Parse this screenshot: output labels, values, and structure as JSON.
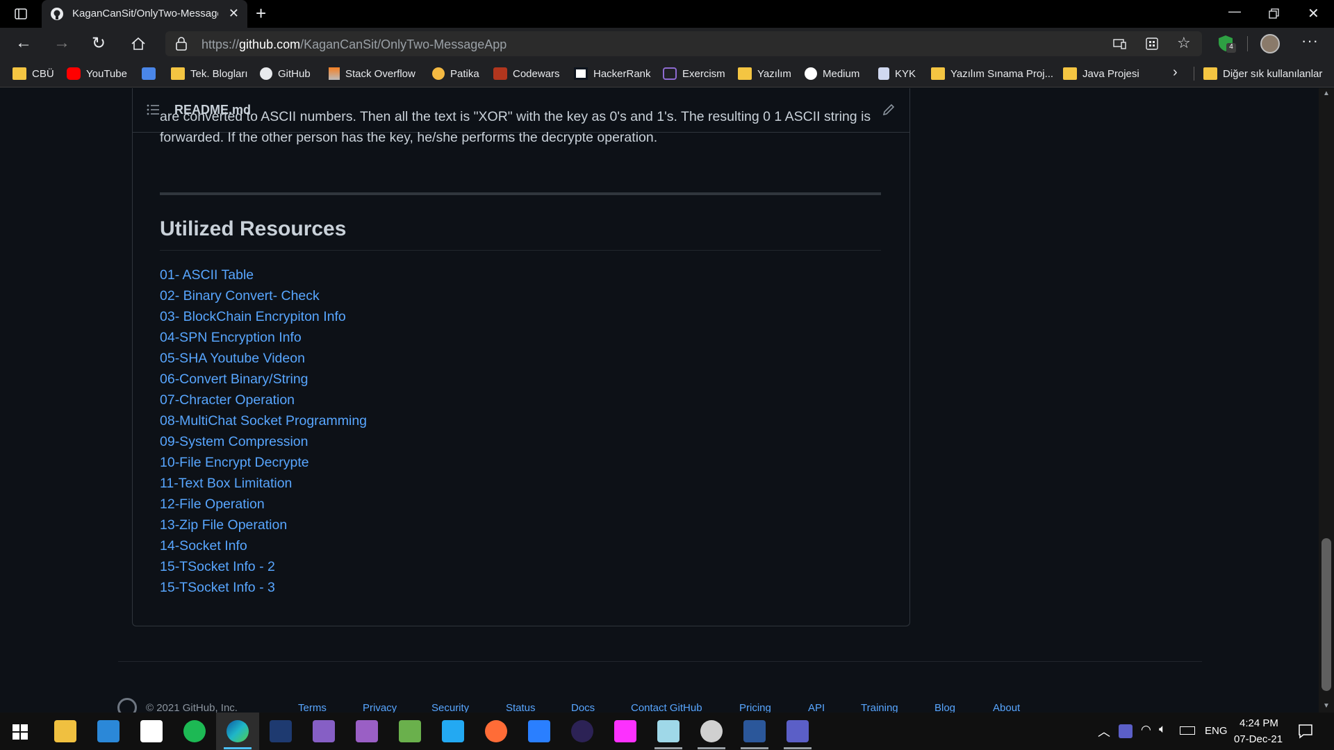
{
  "browser": {
    "tab_title": "KaganCanSit/OnlyTwo-MessageApp",
    "url_prefix": "https://",
    "url_domain": "github.com",
    "url_path": "/KaganCanSit/OnlyTwo-MessageApp",
    "extension_badge": "4"
  },
  "bookmarks": [
    {
      "label": "CBÜ",
      "icon": "folder-icon"
    },
    {
      "label": "YouTube",
      "icon": "youtube-icon"
    },
    {
      "label": "",
      "icon": "translate-icon"
    },
    {
      "label": "Tek. Blogları",
      "icon": "folder-icon"
    },
    {
      "label": "GitHub",
      "icon": "github-icon"
    },
    {
      "label": "Stack Overflow",
      "icon": "stackoverflow-icon"
    },
    {
      "label": "Patika",
      "icon": "patika-icon"
    },
    {
      "label": "Codewars",
      "icon": "codewars-icon"
    },
    {
      "label": "HackerRank",
      "icon": "hackerrank-icon"
    },
    {
      "label": "Exercism",
      "icon": "exercism-icon"
    },
    {
      "label": "Yazılım",
      "icon": "folder-icon"
    },
    {
      "label": "Medium",
      "icon": "medium-icon"
    },
    {
      "label": "KYK",
      "icon": "kyk-icon"
    },
    {
      "label": "Yazılım Sınama Proj...",
      "icon": "folder-icon"
    },
    {
      "label": "Java Projesi",
      "icon": "folder-icon"
    },
    {
      "label": "Diğer sık kullanılanlar",
      "icon": "folder-icon"
    }
  ],
  "readme": {
    "filename": "README.md",
    "intro_line1": "are converted to ASCII numbers. Then all the text is \"XOR\" with the key as 0's and 1's. The resulting 0 1 ASCII string is",
    "intro_line2": "forwarded. If the other person has the key, he/she performs the decrypte operation.",
    "section_title": "Utilized Resources",
    "resources": [
      "01- ASCII Table",
      "02- Binary Convert- Check",
      "03- BlockChain Encrypiton Info",
      "04-SPN Encryption Info",
      "05-SHA Youtube Videon",
      "06-Convert Binary/String",
      "07-Chracter Operation",
      "08-MultiChat Socket Programming",
      "09-System Compression",
      "10-File Encrypt Decrypte",
      "11-Text Box Limitation",
      "12-File Operation",
      "13-Zip File Operation",
      "14-Socket Info",
      "15-TSocket Info - 2",
      "15-TSocket Info - 3"
    ]
  },
  "footer": {
    "copyright": "© 2021 GitHub, Inc.",
    "links": [
      "Terms",
      "Privacy",
      "Security",
      "Status",
      "Docs",
      "Contact GitHub",
      "Pricing",
      "API",
      "Training",
      "Blog",
      "About"
    ]
  },
  "taskbar": {
    "language": "ENG",
    "time": "4:24 PM",
    "date": "07-Dec-21"
  },
  "colors": {
    "link": "#58a6ff",
    "background": "#0d1117",
    "text": "#c9d1d9"
  }
}
